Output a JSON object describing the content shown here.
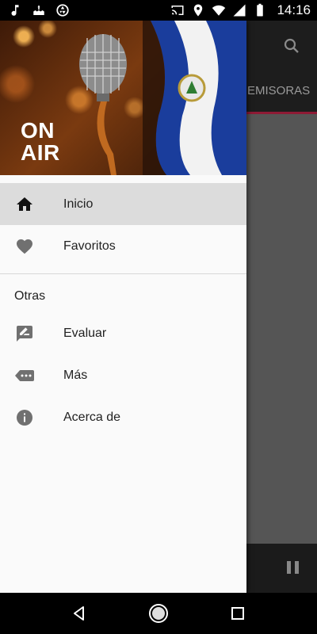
{
  "status_bar": {
    "time": "14:16",
    "left_icons": [
      "music-note-icon",
      "cake-icon",
      "aperture-icon"
    ],
    "right_icons": [
      "cast-icon",
      "location-icon",
      "wifi-icon",
      "signal-icon",
      "battery-icon"
    ]
  },
  "drawer": {
    "header_overlay_text": [
      "ON",
      "AIR"
    ],
    "items": [
      {
        "label": "Inicio",
        "icon": "home-icon",
        "active": true
      },
      {
        "label": "Favoritos",
        "icon": "heart-icon",
        "active": false
      }
    ],
    "section_title": "Otras",
    "other_items": [
      {
        "label": "Evaluar",
        "icon": "rate-review-icon"
      },
      {
        "label": "Más",
        "icon": "more-tag-icon"
      },
      {
        "label": "Acerca de",
        "icon": "info-icon"
      }
    ]
  },
  "background_app": {
    "tab_label": "EMISORAS",
    "toolbar_icons": [
      "search-icon"
    ],
    "player_icons": [
      "pause-icon"
    ]
  },
  "nav_bar": {
    "buttons": [
      "back-icon",
      "home-circle-icon",
      "recents-icon"
    ]
  },
  "colors": {
    "accent_line": "#8e1a35",
    "active_item_bg": "#dcdcdc",
    "drawer_bg": "#fafafa"
  }
}
